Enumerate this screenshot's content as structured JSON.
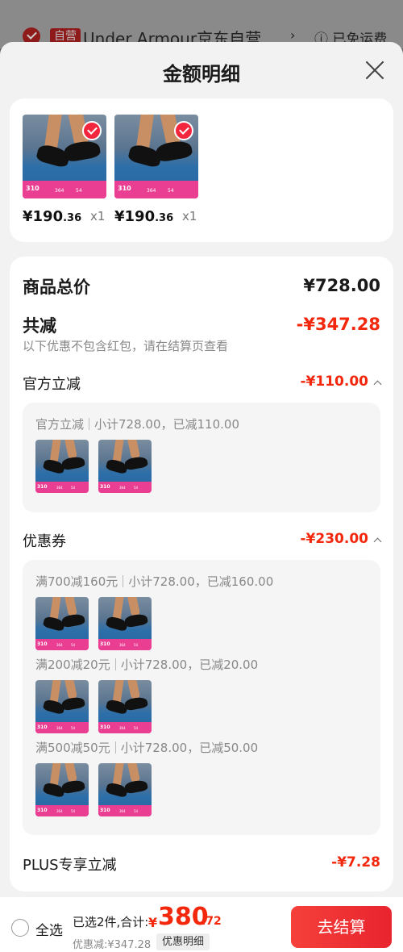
{
  "background": {
    "store_tag": "自营",
    "store_name": "Under Armour京东自营",
    "shipping": "ⓘ 已免运费"
  },
  "sheet": {
    "title": "金额明细"
  },
  "items": [
    {
      "price_int": "¥190",
      "price_dec": ".36",
      "qty": "x1",
      "thumb_price": "310",
      "thumb_mid": "364",
      "thumb_right": "54"
    },
    {
      "price_int": "¥190",
      "price_dec": ".36",
      "qty": "x1",
      "thumb_price": "310",
      "thumb_mid": "364",
      "thumb_right": "54"
    }
  ],
  "breakdown": {
    "total_label": "商品总价",
    "total_value": "¥728.00",
    "reduce_label": "共减",
    "reduce_value": "-¥347.28",
    "reduce_note": "以下优惠不包含红包，请在结算页查看",
    "official": {
      "label": "官方立减",
      "value": "-¥110.00",
      "detail_name": "官方立减",
      "detail_sum": "小计728.00，已减110.00"
    },
    "coupon": {
      "label": "优惠券",
      "value": "-¥230.00",
      "groups": [
        {
          "name": "满700减160元",
          "sum": "小计728.00，已减160.00"
        },
        {
          "name": "满200减20元",
          "sum": "小计728.00，已减20.00"
        },
        {
          "name": "满500减50元",
          "sum": "小计728.00，已减50.00"
        }
      ]
    },
    "plus": {
      "label": "PLUS专享立减",
      "value": "-¥7.28"
    }
  },
  "bottom_bar": {
    "select_all": "全选",
    "selected_summary": "已选2件,合计:",
    "total_yen": "¥",
    "total_int": "380",
    "total_dec": ".72",
    "discount": "优惠减:¥347.28",
    "detail_button": "优惠明细",
    "checkout_button": "去结算"
  },
  "colors": {
    "accent": "#f2270c",
    "checkout": "#e8242e",
    "thumb_band": "#ea3e93"
  }
}
